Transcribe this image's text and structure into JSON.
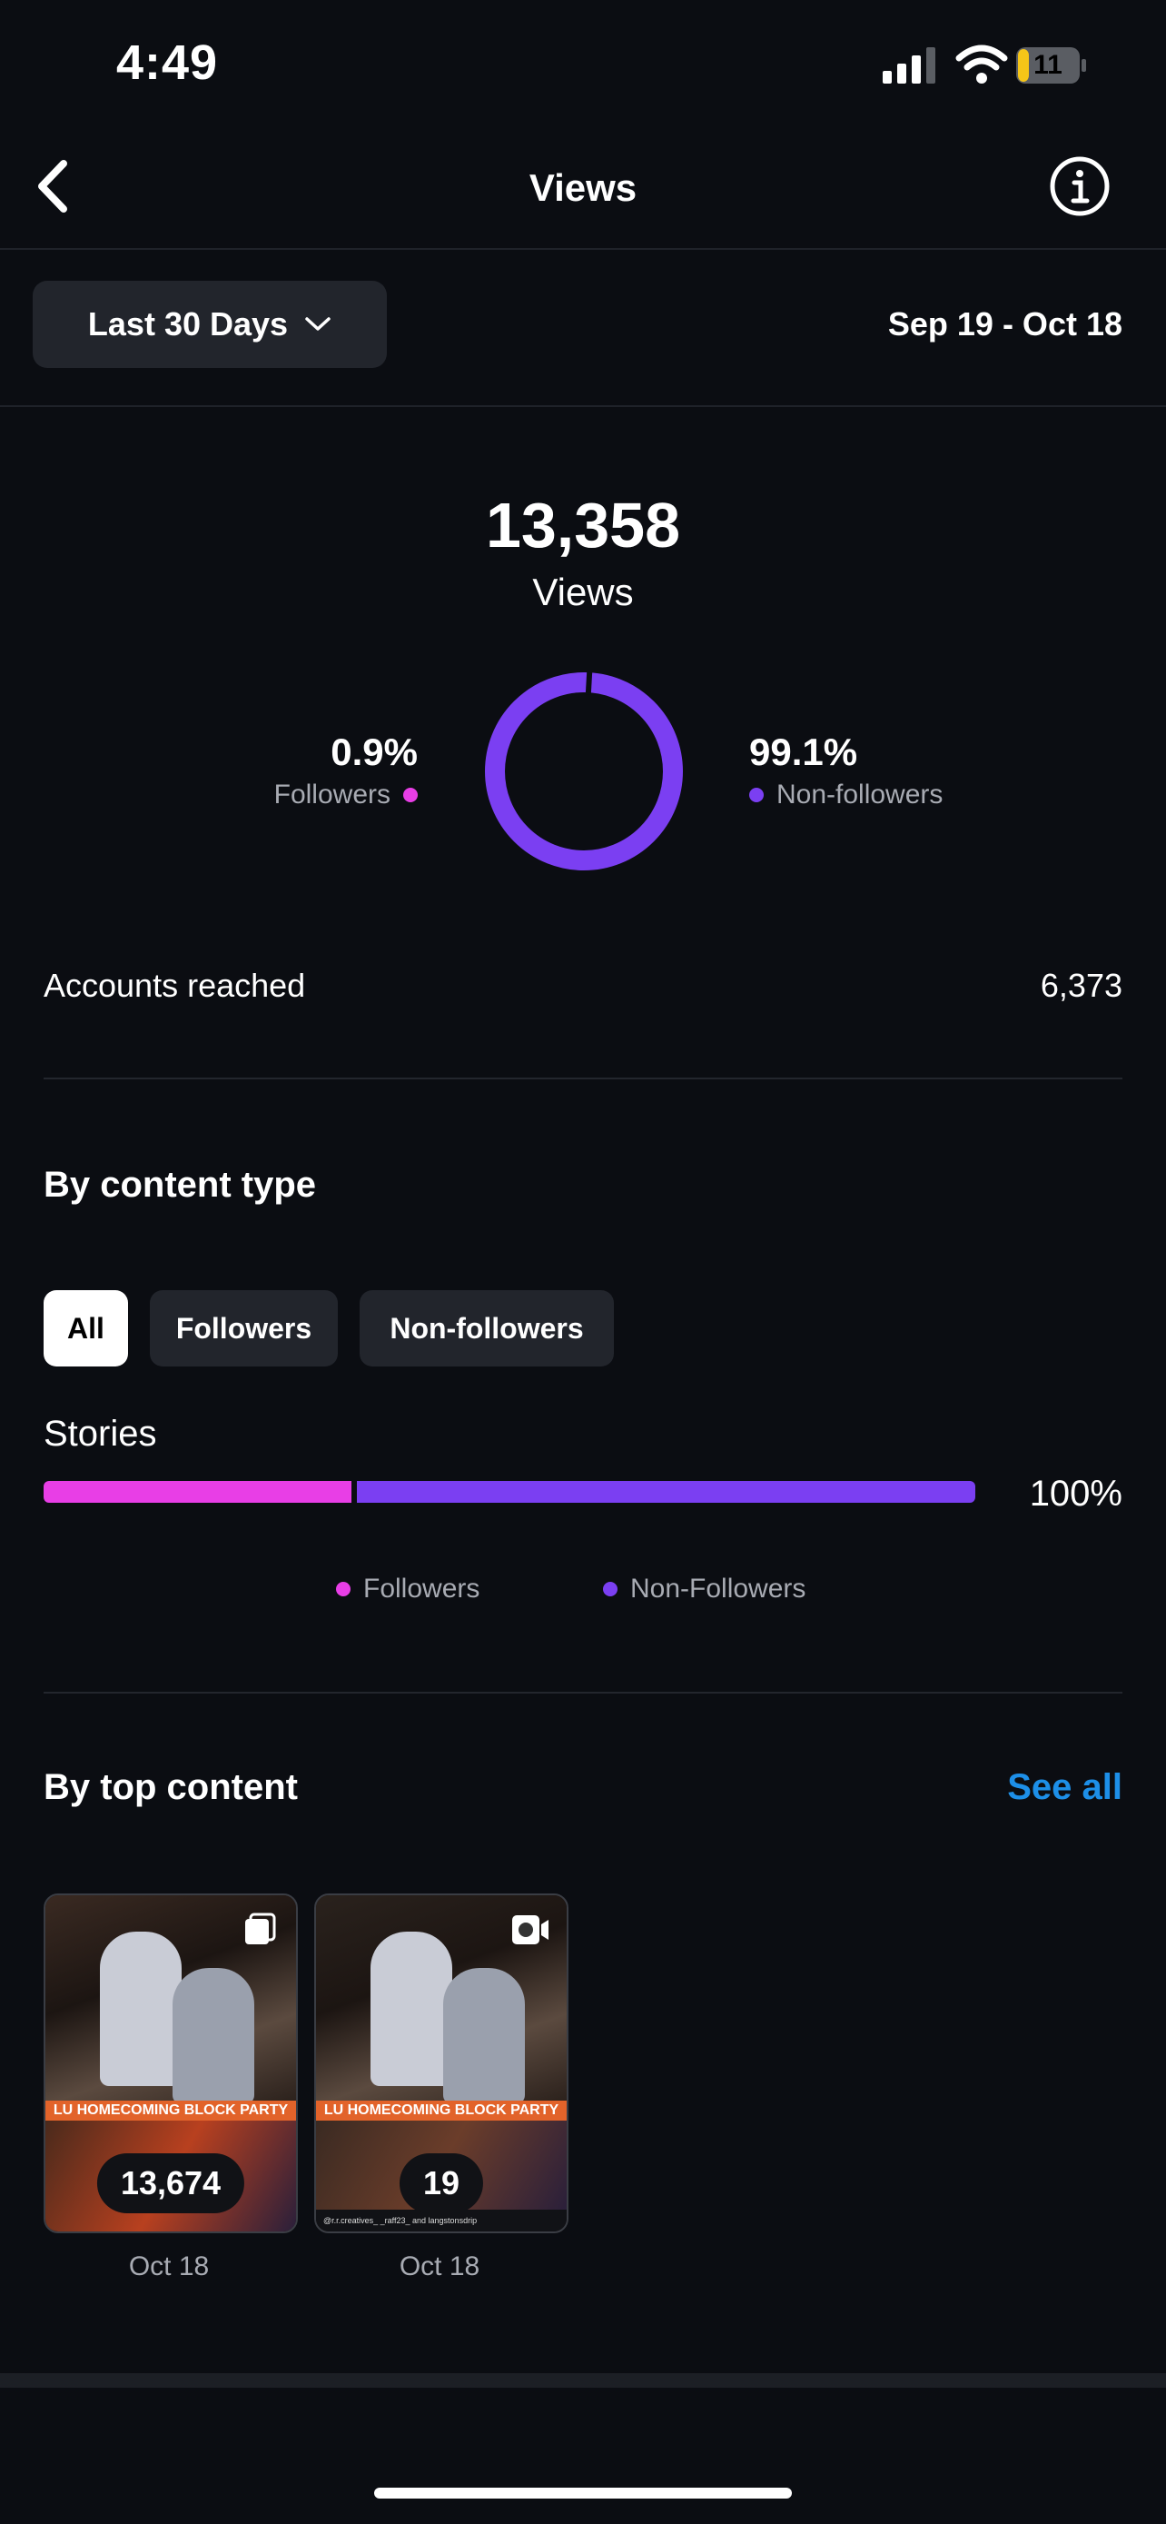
{
  "status_bar": {
    "time": "4:49",
    "battery": "11"
  },
  "header": {
    "title": "Views"
  },
  "range": {
    "label": "Last 30 Days",
    "dates": "Sep 19 - Oct 18"
  },
  "summary": {
    "views_total": "13,358",
    "views_label": "Views",
    "followers_pct": "0.9%",
    "followers_label": "Followers",
    "nonfollowers_pct": "99.1%",
    "nonfollowers_label": "Non-followers",
    "donut_followers_fraction": 0.009
  },
  "accounts": {
    "label": "Accounts reached",
    "value": "6,373"
  },
  "content_type": {
    "title": "By content type",
    "chips": [
      "All",
      "Followers",
      "Non-followers"
    ],
    "active_chip": "All",
    "row_label": "Stories",
    "row_pct": "100%",
    "followers_share": 0.33,
    "legend_followers": "Followers",
    "legend_nonfollowers": "Non-Followers"
  },
  "top_content": {
    "title": "By top content",
    "see_all": "See all",
    "items": [
      {
        "count": "13,674",
        "date": "Oct 18",
        "banner": "LU HOMECOMING BLOCK PARTY"
      },
      {
        "count": "19",
        "date": "Oct 18",
        "banner": "LU HOMECOMING BLOCK PARTY",
        "credit": "@r.r.creatives_ _raff23_ and langstonsdrip"
      }
    ]
  },
  "colors": {
    "followers": "#e83ee6",
    "nonfollowers": "#7b3ff2",
    "accent_link": "#1d8fe8",
    "background": "#0b0d12"
  }
}
